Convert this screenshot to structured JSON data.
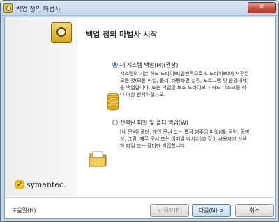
{
  "window": {
    "title": "백업 정의 마법사"
  },
  "page": {
    "title": "백업 정의 마법사 시작"
  },
  "options": [
    {
      "label": "내 시스템 백업(M)(권장)",
      "selected": true,
      "icon": "database-icon",
      "description_lines": [
        "시스템의 기본 하드 드라이브(일반적으로 C 드라이브)에 저장된",
        "모든 것(모든 파일, 폴더, 바탕화면 설정, 프로그램 및 운영체제)",
        "을 백업합니다. 또는 백업할 보조 드라이브나 하드 디스크를 하",
        "나 이상 선택하십시오."
      ]
    },
    {
      "label": "선택된 파일 및 폴더 백업(W)",
      "selected": false,
      "icon": "folder-icon",
      "description_lines": [
        "[내 문서] 폴더, 개인 문서 또는 특정 범주의 파일(예: 음악, 동영",
        "상, 그림, 재무 문서 또는 이메일 메시지)과 같이 사용자가 선택",
        "한 파일 또는 폴더만 백업합니다."
      ]
    }
  ],
  "brand": {
    "name": "symantec."
  },
  "help_link": "도움말(H)",
  "buttons": {
    "back": "< 뒤로(B)",
    "next": "다음(N) >",
    "cancel": "취소"
  },
  "icons": {
    "close": "close-icon",
    "window": "wizard-app-icon",
    "header": "wizard-header-icon"
  }
}
